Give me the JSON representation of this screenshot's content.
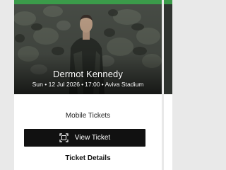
{
  "colors": {
    "accent_green": "#3b9b4a",
    "button_black": "#111111",
    "background": "#e9e9e9"
  },
  "event": {
    "artist": "Dermot Kennedy",
    "date": "Sun • 12 Jul 2026",
    "time": "17:00",
    "venue": "Aviva Stadium",
    "separator": "•"
  },
  "tickets": {
    "section_label": "Mobile Tickets",
    "view_button_label": "View Ticket",
    "view_button_icon": "ticket-scan-icon",
    "details_label": "Ticket Details"
  }
}
